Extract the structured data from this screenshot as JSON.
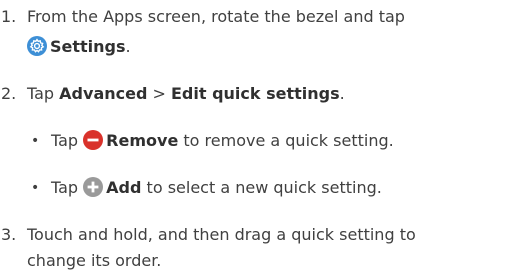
{
  "steps": [
    {
      "number": "1.",
      "line1": "From the Apps screen, rotate the bezel and tap",
      "icon": "settings-gear-icon",
      "bold": "Settings",
      "tail": "."
    },
    {
      "number": "2.",
      "pre": "Tap ",
      "bold1": "Advanced",
      "sep": " > ",
      "bold2": "Edit quick settings",
      "tail": "."
    },
    {
      "number": "3.",
      "line1": "Touch and hold, and then drag a quick setting to",
      "line2": "change its order."
    }
  ],
  "bullets": [
    {
      "pre": "Tap ",
      "icon": "remove-minus-icon",
      "bold": "Remove",
      "post": " to remove a quick setting."
    },
    {
      "pre": "Tap ",
      "icon": "add-plus-icon",
      "bold": "Add",
      "post": " to select a new quick setting."
    }
  ],
  "colors": {
    "text": "#404040",
    "settings_icon": "#3d8fd6",
    "remove_icon": "#d9322b",
    "add_icon": "#9a9a9a"
  }
}
